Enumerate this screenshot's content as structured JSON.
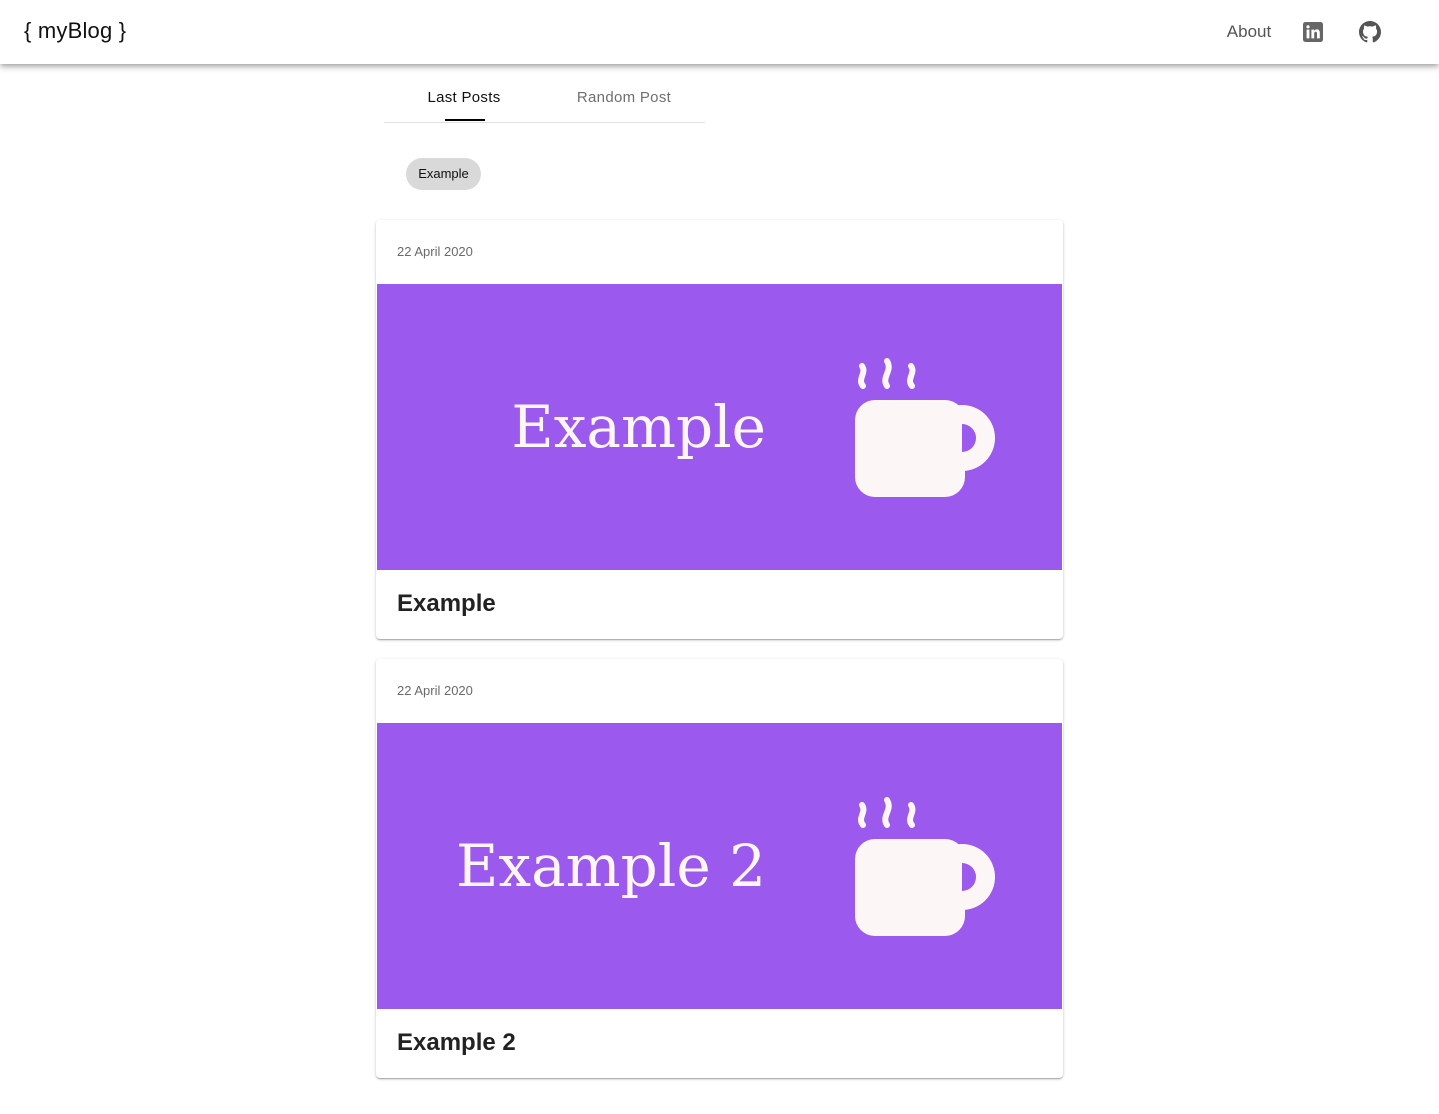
{
  "header": {
    "brand": "{ myBlog }",
    "about_label": "About",
    "linkedin_icon": "linkedin-icon",
    "github_icon": "github-icon"
  },
  "tabs": [
    {
      "label": "Last Posts",
      "selected": true
    },
    {
      "label": "Random Post",
      "selected": false
    }
  ],
  "tags": [
    {
      "label": "Example"
    }
  ],
  "posts": [
    {
      "date": "22 April 2020",
      "image_text": "Example",
      "title": "Example",
      "image_icon": "coffee-cup-icon"
    },
    {
      "date": "22 April 2020",
      "image_text": "Example 2",
      "title": "Example 2",
      "image_icon": "coffee-cup-icon"
    }
  ],
  "colors": {
    "media_background": "#9b59ed",
    "media_foreground": "#fdf6f6",
    "chip_background": "#d9d9d9"
  }
}
